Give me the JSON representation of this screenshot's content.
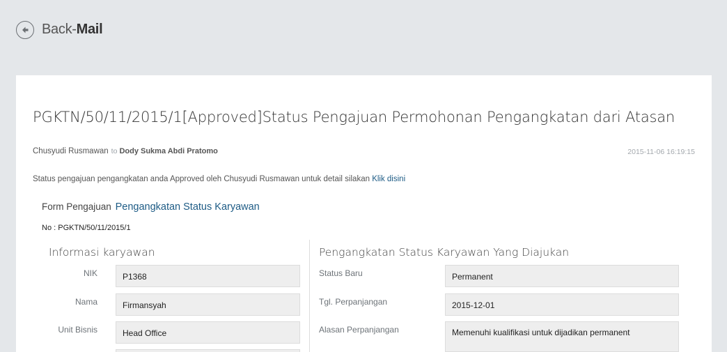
{
  "header": {
    "back_label": "Back-",
    "section": "Mail"
  },
  "mail": {
    "subject": "PGKTN/50/11/2015/1[Approved]Status Pengajuan Permohonan Pengangkatan dari Atasan",
    "sender": "Chusyudi Rusmawan",
    "to_label": "to",
    "recipient": "Dody Sukma Abdi Pratomo",
    "date": "2015-11-06 16:19:15",
    "body_text": "Status pengajuan pengangkatan anda Approved oleh Chusyudi Rusmawan untuk detail silakan ",
    "body_link": "Klik disini"
  },
  "form": {
    "title_prefix": "Form Pengajuan",
    "title_highlight": "Pengangkatan Status Karyawan",
    "number": "No : PGKTN/50/11/2015/1",
    "left": {
      "title": "Informasi karyawan",
      "fields": [
        {
          "label": "NIK",
          "value": "P1368"
        },
        {
          "label": "Nama",
          "value": "Firmansyah"
        },
        {
          "label": "Unit Bisnis",
          "value": "Head Office"
        }
      ]
    },
    "right": {
      "title": "Pengangkatan Status Karyawan Yang Diajukan",
      "fields": [
        {
          "label": "Status Baru",
          "value": "Permanent"
        },
        {
          "label": "Tgl. Perpanjangan",
          "value": "2015-12-01"
        },
        {
          "label": "Alasan Perpanjangan",
          "value": "Memenuhi kualifikasi untuk dijadikan permanent"
        }
      ]
    }
  }
}
